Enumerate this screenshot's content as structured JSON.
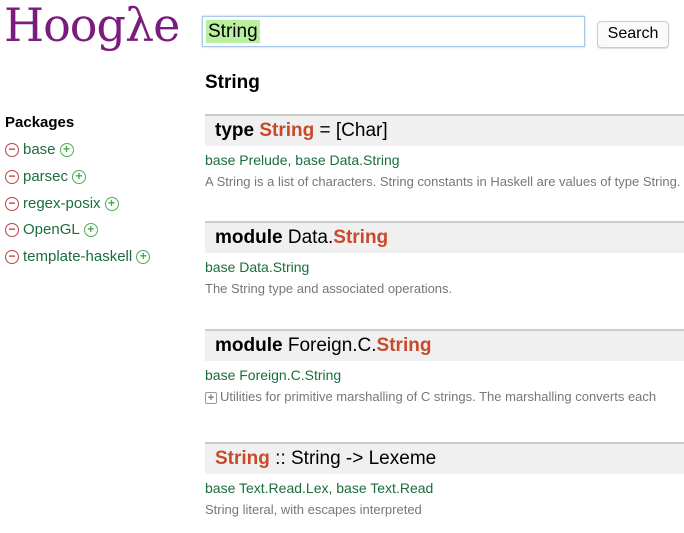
{
  "logo": "Hoogλe",
  "search": {
    "value": "String",
    "button": "Search"
  },
  "heading": "String",
  "packages": {
    "title": "Packages",
    "items": [
      "base",
      "parsec",
      "regex-posix",
      "OpenGL",
      "template-haskell"
    ]
  },
  "results": [
    {
      "pre": "type",
      "pre_bold": true,
      "hl": "String",
      "post": " = [Char]",
      "links": "base Prelude, base Data.String",
      "desc": "A String is a list of characters. String constants in Haskell are values of type String."
    },
    {
      "pre": "module",
      "pre_bold": true,
      "mid": " Data.",
      "hl": "String",
      "post": "",
      "links": "base Data.String",
      "desc": "The String type and associated operations."
    },
    {
      "pre": "module",
      "pre_bold": true,
      "mid": " Foreign.C.",
      "hl": "String",
      "post": "",
      "links": "base Foreign.C.String",
      "desc": "Utilities for primitive marshalling of C strings. The marshalling converts each"
    },
    {
      "hl": "String",
      "post": " :: String -> Lexeme",
      "links": "base Text.Read.Lex, base Text.Read",
      "desc": "String literal, with escapes interpreted"
    }
  ]
}
